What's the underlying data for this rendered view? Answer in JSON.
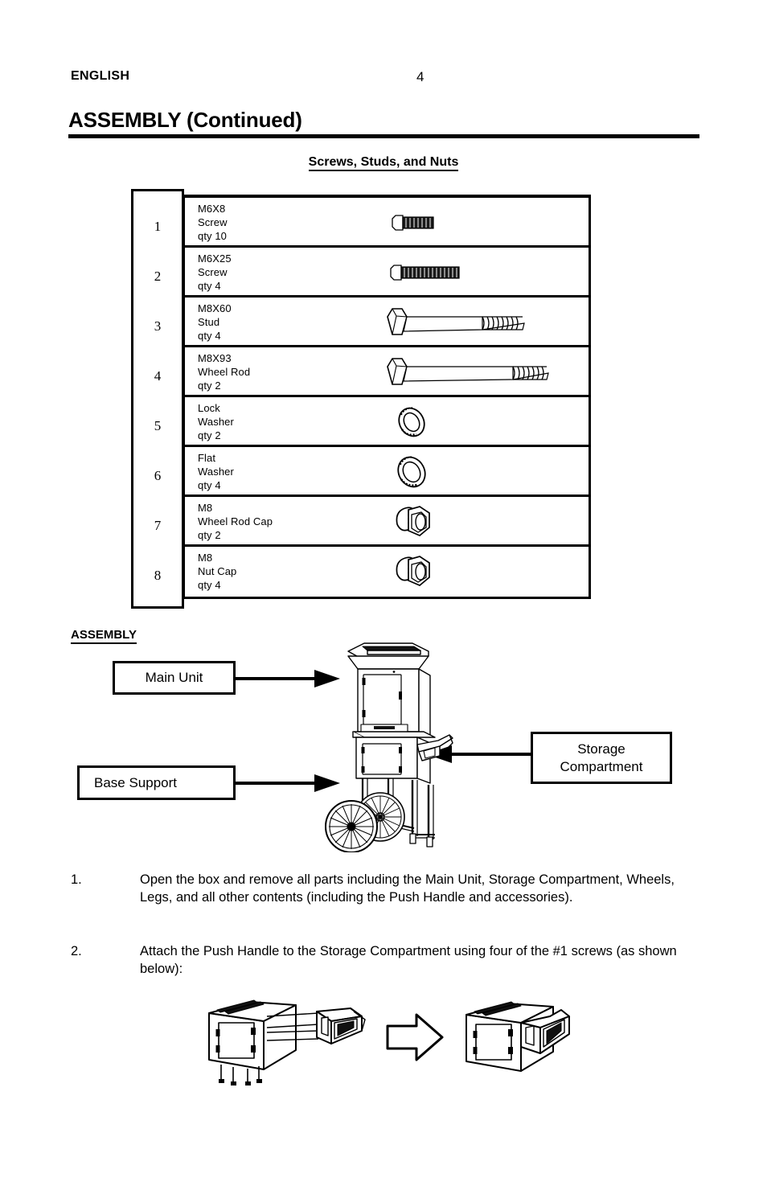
{
  "header": {
    "language": "ENGLISH",
    "page_number": "4"
  },
  "section_title": "ASSEMBLY (Continued)",
  "parts_heading": "Screws, Studs, and Nuts",
  "parts_table": {
    "rows": [
      {
        "index": "1",
        "name": "M6X8",
        "type": "Screw",
        "qty": "qty 10",
        "icon": "hex-bolt-short-icon"
      },
      {
        "index": "2",
        "name": "M6X25",
        "type": "Screw",
        "qty": "qty 4",
        "icon": "hex-bolt-medium-icon"
      },
      {
        "index": "3",
        "name": "M8X60",
        "type": "Stud",
        "qty": "qty 4",
        "icon": "hex-stud-long-icon"
      },
      {
        "index": "4",
        "name": "M8X93",
        "type": "Wheel Rod",
        "qty": "qty 2",
        "icon": "hex-wheel-rod-icon"
      },
      {
        "index": "5",
        "name": "Lock",
        "type": "Washer",
        "qty": "qty 2",
        "icon": "lock-washer-icon"
      },
      {
        "index": "6",
        "name": "Flat",
        "type": "Washer",
        "qty": "qty 4",
        "icon": "flat-washer-icon"
      },
      {
        "index": "7",
        "name": "M8",
        "type": "Wheel Rod Cap",
        "qty": "qty 2",
        "icon": "cap-nut-icon"
      },
      {
        "index": "8",
        "name": "M8",
        "type": "Nut Cap",
        "qty": "qty 4",
        "icon": "cap-nut-icon"
      }
    ]
  },
  "assembly": {
    "label": "ASSEMBLY",
    "callouts": {
      "main_unit": "Main Unit",
      "base_support": "Base Support",
      "storage_compartment_line1": "Storage",
      "storage_compartment_line2": "Compartment"
    }
  },
  "steps": [
    {
      "number": "1.",
      "text": "Open the box and remove all parts including the Main Unit, Storage Compartment, Wheels, Legs, and all other contents (including the Push Handle and accessories)."
    },
    {
      "number": "2.",
      "text": "Attach the Push Handle to the Storage Compartment using four of the #1 screws (as shown below):"
    }
  ],
  "colors": {
    "ink": "#000000",
    "paper": "#ffffff"
  }
}
